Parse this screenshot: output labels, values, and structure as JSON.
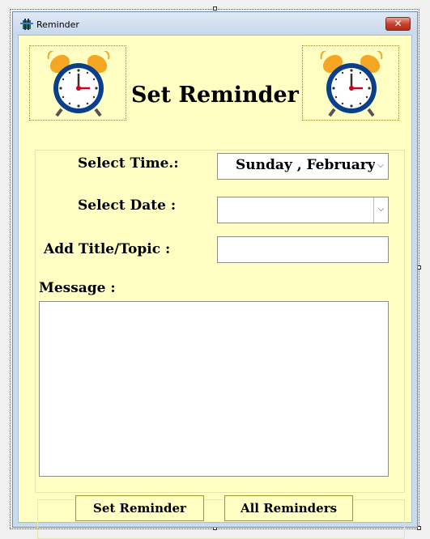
{
  "window": {
    "title": "Reminder",
    "close_label": "✕"
  },
  "header": {
    "title": "Set Reminder"
  },
  "form": {
    "time_label": "Select Time.:",
    "time_value": "Sunday   ,  February",
    "date_label": "Select Date :",
    "date_value": "",
    "title_label": "Add Title/Topic :",
    "title_value": "",
    "message_label": "Message :",
    "message_value": ""
  },
  "buttons": {
    "set_reminder": "Set Reminder",
    "all_reminders": "All Reminders"
  },
  "icons": {
    "dropdown": "⌵",
    "clock": "alarm-clock-icon"
  },
  "colors": {
    "background": "#ffffc4",
    "clock_ring": "#0a3f8c",
    "bells": "#f5a623",
    "close_button": "#c8412f"
  }
}
